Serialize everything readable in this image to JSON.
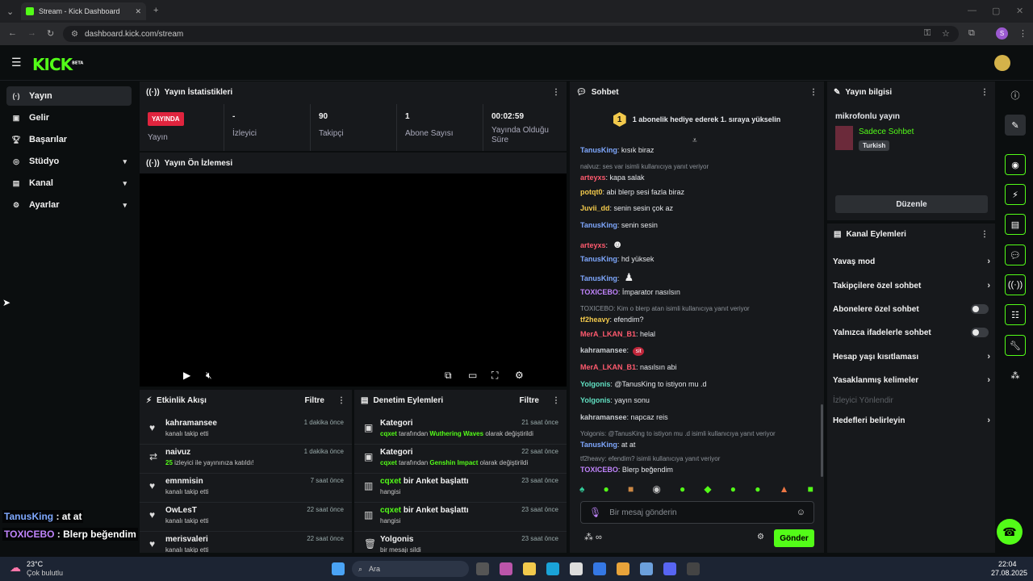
{
  "browser": {
    "tab_title": "Stream - Kick Dashboard",
    "url": "dashboard.kick.com/stream",
    "profile_initial": "S"
  },
  "app": {
    "logo_text": "KICK",
    "logo_badge": "BETA",
    "accent": "#53fc18"
  },
  "sidebar": {
    "items": [
      {
        "label": "Yayın",
        "icon": "broadcast-icon"
      },
      {
        "label": "Gelir",
        "icon": "money-icon"
      },
      {
        "label": "Başarılar",
        "icon": "trophy-icon"
      },
      {
        "label": "Stüdyo",
        "icon": "studio-icon"
      },
      {
        "label": "Kanal",
        "icon": "channel-icon"
      },
      {
        "label": "Ayarlar",
        "icon": "gear-icon"
      }
    ]
  },
  "stats": {
    "title": "Yayın İstatistikleri",
    "live_badge": "YAYINDA",
    "live_label": "Yayın",
    "viewers_value": "-",
    "viewers_label": "İzleyici",
    "followers_value": "90",
    "followers_label": "Takipçi",
    "subs_value": "1",
    "subs_label": "Abone Sayısı",
    "duration_value": "00:02:59",
    "duration_label_1": "Yayında Olduğu",
    "duration_label_2": "Süre"
  },
  "preview": {
    "title": "Yayın Ön İzlemesi"
  },
  "activity": {
    "title": "Etkinlik Akışı",
    "filter": "Filtre",
    "items": [
      {
        "name": "kahramansee",
        "desc": "kanalı takip etti",
        "time": "1 dakika önce",
        "icon": "heart-icon"
      },
      {
        "name": "naivuz",
        "desc_count": "25",
        "desc": "izleyici ile yayınınıza katıldı!",
        "time": "1 dakika önce",
        "icon": "raid-icon"
      },
      {
        "name": "emnmisin",
        "desc": "kanalı takip etti",
        "time": "7 saat önce",
        "icon": "heart-icon"
      },
      {
        "name": "OwLesT",
        "desc": "kanalı takip etti",
        "time": "22 saat önce",
        "icon": "heart-icon"
      },
      {
        "name": "merisvaleri",
        "desc": "kanalı takip etti",
        "time": "22 saat önce",
        "icon": "heart-icon"
      }
    ]
  },
  "moderation": {
    "title": "Denetim Eylemleri",
    "filter": "Filtre",
    "items": [
      {
        "title": "Kategori",
        "user": "cqxet",
        "mid": "tarafından",
        "target": "Wuthering Waves",
        "end": "olarak değiştirildi",
        "time": "21 saat önce"
      },
      {
        "title": "Kategori",
        "user": "cqxet",
        "mid": "tarafından",
        "target": "Genshin Impact",
        "end": "olarak değiştirildi",
        "time": "22 saat önce"
      },
      {
        "title_user": "cqxet",
        "title_rest": "bir Anket başlattı",
        "desc": "hangisi",
        "time": "23 saat önce"
      },
      {
        "title_user": "cqxet",
        "title_rest": "bir Anket başlattı",
        "desc": "hangisi",
        "time": "23 saat önce"
      },
      {
        "title": "Yolgonis",
        "desc": "bir mesajı sildi",
        "time": "23 saat önce"
      }
    ]
  },
  "chat": {
    "title": "Sohbet",
    "gift_number": "1",
    "gift_text": "1 abonelik hediye ederek 1. sıraya yükselin",
    "messages": [
      {
        "user": "TanusKing",
        "text": ": kısık biraz",
        "cls": "u-blue"
      },
      {
        "reply": "nalvuz: ses var isimli kullanıcıya yanıt veriyor"
      },
      {
        "user": "arteyxs",
        "text": ": kapa salak",
        "cls": "u-red"
      },
      {
        "user": "potqt0",
        "text": ": abi blerp sesi fazla biraz",
        "cls": "u-yel"
      },
      {
        "user": "Juvii_dd",
        "text": ": senin sesin çok az",
        "cls": "u-yel"
      },
      {
        "user": "TanusKing",
        "text": ": senin sesin",
        "cls": "u-blue"
      },
      {
        "user": "arteyxs",
        "text": ":",
        "cls": "u-red",
        "emote": "☻"
      },
      {
        "user": "TanusKing",
        "text": ": hd yüksek",
        "cls": "u-blue"
      },
      {
        "user": "TanusKing",
        "text": ":",
        "cls": "u-blue",
        "emote": "♟"
      },
      {
        "user": "TOXICEBO",
        "text": ": İmparator nasılsın",
        "cls": "u-pur"
      },
      {
        "reply": "TOXICEBO: Kim o blerp atan isimli kullanıcıya yanıt veriyor"
      },
      {
        "user": "tf2heavy",
        "text": ": efendim?",
        "cls": "u-yel"
      },
      {
        "user": "MerA_LKAN_B1",
        "text": ": helal",
        "cls": "u-red"
      },
      {
        "user": "kahramansee",
        "text": ":",
        "cls": "u-gry",
        "emote": "sit"
      },
      {
        "user": "MerA_LKAN_B1",
        "text": ": nasılsın abi",
        "cls": "u-red"
      },
      {
        "user": "Yolgonis",
        "text": ": @TanusKing to istiyon mu .d",
        "cls": "u-grn"
      },
      {
        "user": "Yolgonis",
        "text": ": yayın sonu",
        "cls": "u-grn"
      },
      {
        "user": "kahramansee",
        "text": ": napcaz reis",
        "cls": "u-gry"
      },
      {
        "reply": "Yolgonis: @TanusKing to istiyon mu .d isimli kullanıcıya yanıt veriyor"
      },
      {
        "user": "TanusKing",
        "text": ": at at",
        "cls": "u-blue"
      },
      {
        "reply": "tf2heavy: efendim? isimli kullanıcıya yanıt veriyor"
      },
      {
        "user": "TOXICEBO",
        "text": ": Blerp beğendim",
        "cls": "u-pur"
      }
    ],
    "input_placeholder": "Bir mesaj gönderin",
    "send_label": "Gönder"
  },
  "stream_info": {
    "title": "Yayın bilgisi",
    "stream_title": "mikrofonlu yayın",
    "category": "Sadece Sohbet",
    "tag": "Turkish",
    "edit_label": "Düzenle"
  },
  "channel_actions": {
    "title": "Kanal Eylemleri",
    "items": [
      {
        "label": "Yavaş mod",
        "ctrl": "chevron"
      },
      {
        "label": "Takipçilere özel sohbet",
        "ctrl": "chevron"
      },
      {
        "label": "Abonelere özel sohbet",
        "ctrl": "toggle"
      },
      {
        "label": "Yalnızca ifadelerle sohbet",
        "ctrl": "toggle"
      },
      {
        "label": "Hesap yaşı kısıtlaması",
        "ctrl": "chevron"
      },
      {
        "label": "Yasaklanmış kelimeler",
        "ctrl": "chevron"
      },
      {
        "label": "İzleyici Yönlendir",
        "ctrl": "none",
        "disabled": true
      },
      {
        "label": "Hedefleri belirleyin",
        "ctrl": "chevron"
      }
    ]
  },
  "overlay_chat": [
    {
      "user": "TanusKing",
      "text": " : at at"
    },
    {
      "user": "TOXICEBO",
      "text": " : Blerp beğendim"
    }
  ],
  "taskbar": {
    "temp": "23°C",
    "weather": "Çok bulutlu",
    "search": "Ara",
    "time": "22:04",
    "date": "27.08.2025"
  }
}
